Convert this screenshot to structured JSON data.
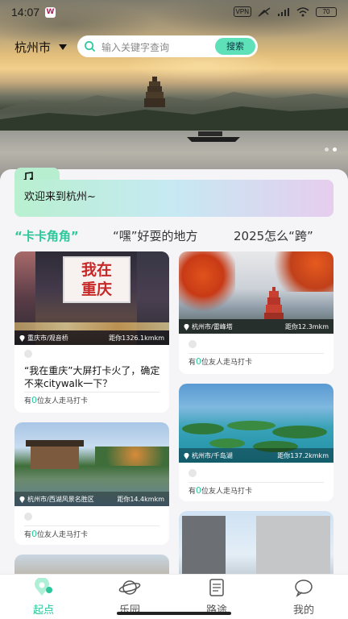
{
  "status": {
    "time": "14:07",
    "vpn": "VPN",
    "network": "HD",
    "battery": "70"
  },
  "header": {
    "city": "杭州市",
    "search_placeholder": "输入关键字查询",
    "search_button": "搜索"
  },
  "welcome": {
    "text": "欢迎来到杭州~"
  },
  "tabs": [
    {
      "label": "“卡卡角角”"
    },
    {
      "label": "“嘿”好耍的地方"
    },
    {
      "label": "2025怎么“跨”"
    }
  ],
  "cards": [
    {
      "location": "重庆市/观音桥",
      "distance": "距你1326.1kmkm",
      "title": "“我在重庆”大屏打卡火了，确定不来citywalk一下？",
      "checkin_prefix": "有",
      "count": "0",
      "checkin_suffix": "位友人走马打卡",
      "sign_text": "我在\n重庆"
    },
    {
      "location": "杭州市/雷峰塔",
      "distance": "距你12.3mkm",
      "checkin_prefix": "有",
      "count": "0",
      "checkin_suffix": "位友人走马打卡"
    },
    {
      "location": "杭州市/千岛湖",
      "distance": "距你137.2kmkm",
      "checkin_prefix": "有",
      "count": "0",
      "checkin_suffix": "位友人走马打卡"
    },
    {
      "location": "杭州市/西湖风景名胜区",
      "distance": "距你14.4kmkm",
      "checkin_prefix": "有",
      "count": "0",
      "checkin_suffix": "位友人走马打卡"
    }
  ],
  "nav": [
    {
      "label": "起点",
      "icon": "pin-icon",
      "active": true
    },
    {
      "label": "乐园",
      "icon": "planet-icon"
    },
    {
      "label": "路途",
      "icon": "notebook-icon"
    },
    {
      "label": "我的",
      "icon": "chat-bubble-icon"
    }
  ],
  "colors": {
    "accent": "#2bc79a",
    "button": "#5ee0b8"
  }
}
